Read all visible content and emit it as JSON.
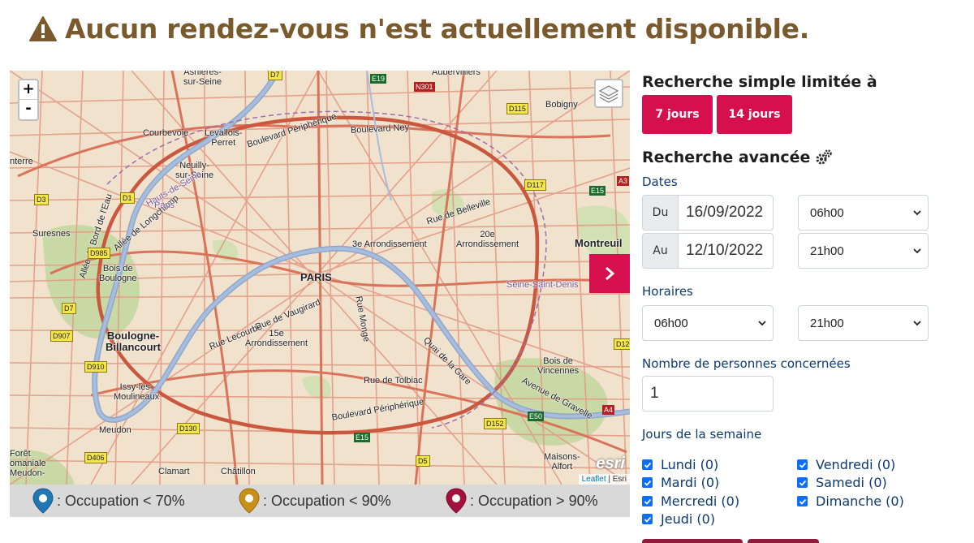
{
  "alert": {
    "icon": "warning-triangle-icon",
    "text": "Aucun rendez-vous n'est actuellement disponible.",
    "color": "#7a5a2c"
  },
  "map": {
    "zoom_in": "+",
    "zoom_out": "-",
    "places": {
      "asnieres": "Asnières-\nsur-Seine",
      "aubervilliers": "Aubervilliers",
      "bobigny": "Bobigny",
      "courbevoie": "Courbevoie",
      "levallois": "Levallois-\nPerret",
      "neuilly": "Neuilly-\nsur-Seine",
      "nanterre": "nterre",
      "suresnes": "Suresnes",
      "paris": "PARIS",
      "arr3": "3e Arrondissement",
      "arr20": "20e\nArrondissement",
      "montreuil": "Montreuil",
      "bois_boulogne": "Bois de\nBoulogne",
      "boulogne": "Boulogne-\nBillancourt",
      "arr15": "15e\nArrondissement",
      "issy": "Issy-les-\nMoulineaux",
      "bois_vincennes": "Bois de\nVincennes",
      "meudon": "Meudon",
      "clamart": "Clamart",
      "chatillon": "Châtillon",
      "maisons": "Maisons-\nAlfort",
      "foret": "Forêt\nomaniale\nMeudon-"
    },
    "streets": {
      "ney": "Boulevard Ney",
      "belleville": "Rue de Belleville",
      "vaugirard": "Rue de Vaugirard",
      "lecourbe": "Rue Lecourbe",
      "tolbiac": "Rue de Tolbiac",
      "longchamp": "Allée de Longchamp",
      "bord_eau": "Allée du Bord de l'Eau",
      "peripherique_n": "Boulevard Périphérique",
      "peripherique_s": "Boulevard Périphérique",
      "monge": "Rue Monge",
      "quai_gare": "Quai de la Gare",
      "gravelle": "Avenue de Gravelle",
      "seine_st_denis": "Seine-Saint-Denis",
      "hauts_seine": "Hauts-de-Seine",
      "paris_dept": "Paris"
    },
    "roads": [
      "D7",
      "E19",
      "N301",
      "D115",
      "D117",
      "E15",
      "A3",
      "D3",
      "D1",
      "D985",
      "D7",
      "D907",
      "D910",
      "D130",
      "D406",
      "D152",
      "E50",
      "A4",
      "E15",
      "D5",
      "D120"
    ],
    "attribution_leaflet": "Leaflet",
    "attribution_sep": " | ",
    "attribution_esri": "Esri",
    "esri_logo": "esri"
  },
  "legend": [
    {
      "icon": "blue-marker-icon",
      "color": "#1f77b4",
      "text": ": Occupation < 70%"
    },
    {
      "icon": "orange-marker-icon",
      "color": "#c8901a",
      "text": ": Occupation < 90%"
    },
    {
      "icon": "red-marker-icon",
      "color": "#a3123f",
      "text": ": Occupation > 90%"
    }
  ],
  "panel": {
    "simple_title": "Recherche simple limitée à",
    "btn_7": "7 jours",
    "btn_14": "14 jours",
    "advanced_title": "Recherche avancée",
    "dates_label": "Dates",
    "du_label": "Du",
    "du_value": "16/09/2022",
    "du_time": "06h00",
    "au_label": "Au",
    "au_value": "12/10/2022",
    "au_time": "21h00",
    "horaires_label": "Horaires",
    "h_start": "06h00",
    "h_end": "21h00",
    "persons_label": "Nombre de personnes concernées",
    "persons_value": "1",
    "days_label": "Jours de la semaine",
    "days": {
      "lundi": "Lundi (0)",
      "mardi": "Mardi (0)",
      "mercredi": "Mercredi (0)",
      "jeudi": "Jeudi (0)",
      "vendredi": "Vendredi (0)",
      "samedi": "Samedi (0)",
      "dimanche": "Dimanche (0)"
    }
  },
  "colors": {
    "accent": "#d6104f",
    "label": "#0b3a6e",
    "checkbox": "#0d6efd"
  }
}
